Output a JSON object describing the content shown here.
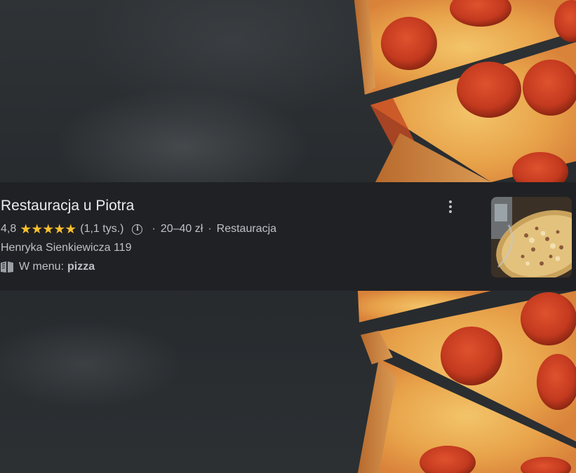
{
  "place": {
    "name": "Restauracja u Piotra",
    "rating": "4,8",
    "stars": 5,
    "review_count": "(1,1 tys.)",
    "separator": "·",
    "price_range": "20–40 zł",
    "category": "Restauracja",
    "address": "Henryka Sienkiewicza 119",
    "menu_label": "W menu:",
    "menu_item": "pizza"
  },
  "icons": {
    "info": "info-icon",
    "menu": "menu-book-icon",
    "more": "more-vert-icon",
    "star": "star-icon"
  },
  "colors": {
    "card_bg": "#202124",
    "title": "#e8eaed",
    "secondary_text": "#bdc1c6",
    "star": "#fbc02d"
  }
}
